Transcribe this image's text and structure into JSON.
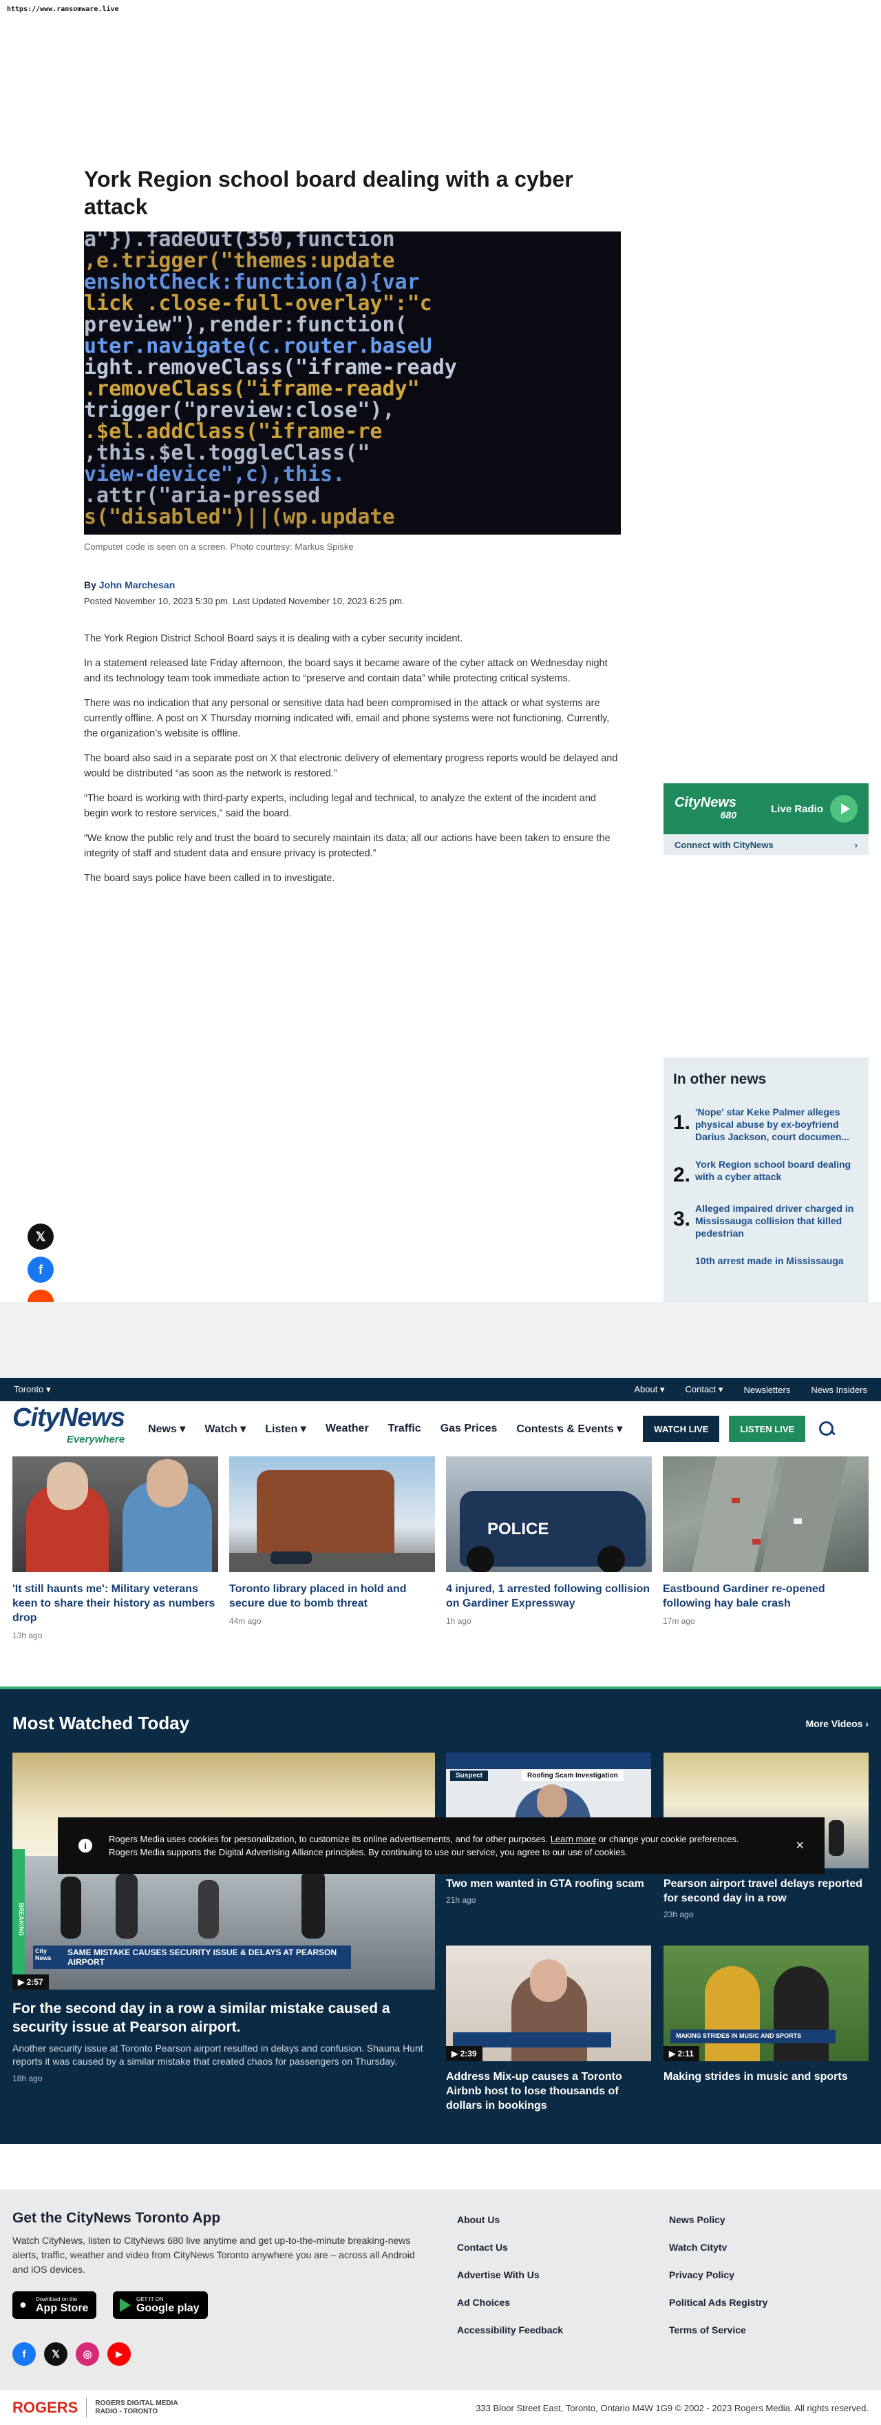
{
  "url": "https://www.ransomware.live",
  "article": {
    "headline": "York Region school board dealing with a cyber attack",
    "caption": "Computer code is seen on a screen. Photo courtesy: Markus Spiske",
    "byline_prefix": "By",
    "author": "John Marchesan",
    "posted": "Posted November 10, 2023 5:30 pm.  Last Updated November 10, 2023 6:25 pm.",
    "paragraphs": [
      "The York Region District School Board says it is dealing with a cyber security incident.",
      "In a statement released late Friday afternoon, the board says it became aware of the cyber attack on Wednesday night and its technology team took immediate action to “preserve and contain data” while protecting critical systems.",
      "There was no indication that any personal or sensitive data had been compromised in the attack or what systems are currently offline. A post on X Thursday morning indicated wifi, email and phone systems were not functioning. Currently, the organization’s website is offline.",
      "The board also said in a separate post on X that electronic delivery of elementary progress reports would be delayed and would be distributed “as soon as the network is restored.”",
      "“The board is working with third-party experts, including legal and technical, to analyze the extent of the incident and begin work to restore services,” said the board.",
      "“We know the public rely and trust the board to securely maintain its data; all our actions have been taken to ensure the integrity of staff and student data and ensure privacy is protected.”",
      "The board says police have been called in to investigate."
    ],
    "code_lines": [
      "a\"}).fadeOut(350,function",
      ",e.trigger(\"themes:update",
      "enshotCheck:function(a){var",
      "lick .close-full-overlay\":\"c",
      "preview\"),render:function(",
      "uter.navigate(c.router.baseU",
      "ight.removeClass(\"iframe-ready",
      ".removeClass(\"iframe-ready\"",
      "trigger(\"preview:close\"),",
      ".$el.addClass(\"iframe-re",
      ",this.$el.toggleClass(\"",
      "view-device\",c),this.",
      ".attr(\"aria-pressed",
      "s(\"disabled\")||(wp.update"
    ]
  },
  "radio": {
    "logo_main": "CityNews",
    "logo_sub": "680",
    "live_label": "Live Radio",
    "connect_label": "Connect with CityNews",
    "chevron": "›"
  },
  "other_news": {
    "title": "In other news",
    "items": [
      {
        "num": "1.",
        "text": "'Nope' star Keke Palmer alleges physical abuse by ex-boyfriend Darius Jackson, court documen..."
      },
      {
        "num": "2.",
        "text": "York Region school board dealing with a cyber attack"
      },
      {
        "num": "3.",
        "text": "Alleged impaired driver charged in Mississauga collision that killed pedestrian"
      },
      {
        "num": "",
        "text": "10th arrest made in Mississauga"
      }
    ]
  },
  "share": {
    "x": "𝕏",
    "facebook": "f",
    "reddit": "r"
  },
  "topbar": {
    "city": "Toronto ▾",
    "links": [
      "About ▾",
      "Contact ▾",
      "Newsletters",
      "News Insiders"
    ]
  },
  "nav": {
    "logo": "CityNews",
    "logo_sub": "Everywhere",
    "items": [
      "News ▾",
      "Watch ▾",
      "Listen ▾",
      "Weather",
      "Traffic",
      "Gas Prices",
      "Contests & Events ▾"
    ],
    "watch_live": "WATCH LIVE",
    "listen_live": "LISTEN LIVE"
  },
  "cards": [
    {
      "title": "'It still haunts me': Military veterans keen to share their history as numbers drop",
      "time": "13h ago"
    },
    {
      "title": "Toronto library placed in hold and secure due to bomb threat",
      "time": "44m ago"
    },
    {
      "title": "4 injured, 1 arrested following collision on Gardiner Expressway",
      "time": "1h ago"
    },
    {
      "title": "Eastbound Gardiner re-opened following hay bale crash",
      "time": "17m ago"
    }
  ],
  "police_text": "POLICE",
  "watched": {
    "title": "Most Watched Today",
    "more": "More Videos ›",
    "feature": {
      "title": "For the second day in a row a similar mistake caused a security issue at Pearson airport.",
      "desc": "Another security issue at Toronto Pearson airport resulted in delays and confusion. Shauna Hunt reports it was caused by a similar mistake that created chaos for passengers on Thursday.",
      "time": "18h ago",
      "duration": "▶ 2:57",
      "lower_third": "SAME MISTAKE CAUSES SECURITY ISSUE & DELAYS AT PEARSON AIRPORT",
      "side_tag": "BREAKING"
    },
    "minis": [
      {
        "title": "Two men wanted in GTA roofing scam",
        "time": "21h ago",
        "duration": "",
        "label": "Roofing Scam Investigation",
        "tag": "Suspect"
      },
      {
        "title": "Pearson airport travel delays reported for second day in a row",
        "time": "23h ago",
        "duration": ""
      },
      {
        "title": "Address Mix-up causes a Toronto Airbnb host to lose thousands of dollars in bookings",
        "time": "",
        "duration": "▶ 2:39"
      },
      {
        "title": "Making strides in music and sports",
        "time": "",
        "duration": "▶ 2:11",
        "label": "MAKING STRIDES IN MUSIC AND SPORTS"
      }
    ]
  },
  "cookie": {
    "icon": "i",
    "text": "Rogers Media uses cookies for personalization, to customize its online advertisements, and for other purposes.",
    "learn_more": "Learn more",
    "text2": "or change your cookie preferences. Rogers Media supports the Digital Advertising Alliance principles. By continuing to use our service, you agree to our use of cookies.",
    "close": "×"
  },
  "footer": {
    "app_title": "Get the CityNews Toronto App",
    "app_desc": "Watch CityNews, listen to CityNews 680 live anytime and get up-to-the-minute breaking-news alerts, traffic, weather and video from CityNews Toronto anywhere you are – across all Android and iOS devices.",
    "appstore_small": "Download on the",
    "appstore": "App Store",
    "gplay_small": "GET IT ON",
    "gplay": "Google play",
    "col1": [
      "About Us",
      "Contact Us",
      "Advertise With Us",
      "Ad Choices",
      "Accessibility Feedback"
    ],
    "col2": [
      "News Policy",
      "Watch Citytv",
      "Privacy Policy",
      "Political Ads Registry",
      "Terms of Service"
    ],
    "social": {
      "facebook": "f",
      "x": "𝕏",
      "instagram": "◎",
      "youtube": "▶"
    },
    "rogers": "ROGERS",
    "rogers_sub1": "ROGERS DIGITAL MEDIA",
    "rogers_sub2": "RADIO - TORONTO",
    "copyright": "333 Bloor Street East, Toronto, Ontario M4W 1G9 © 2002 - 2023 Rogers Media. All rights reserved."
  },
  "colors": {
    "accent_green": "#1f8a5b",
    "navy": "#0b2a44",
    "link_blue": "#173f73"
  }
}
